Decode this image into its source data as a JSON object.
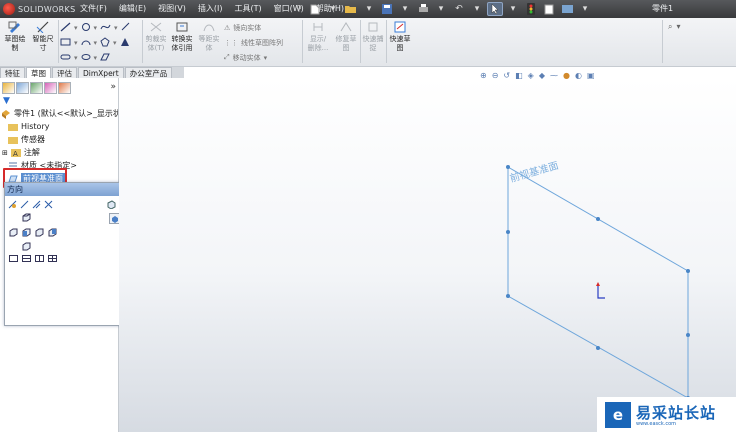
{
  "app": {
    "brand": "SOLIDWORKS",
    "menu": [
      "文件(F)",
      "编辑(E)",
      "视图(V)",
      "插入(I)",
      "工具(T)",
      "窗口(W)",
      "帮助(H)"
    ],
    "document_title": "零件1"
  },
  "commandmanager": {
    "sketch_buttons": [
      {
        "label": "草图绘\n制"
      },
      {
        "label": "智能尺\n寸"
      }
    ],
    "convert_buttons": [
      {
        "label": "剪裁实\n体(T)",
        "disabled": true
      },
      {
        "label": "转换实\n体引用",
        "disabled": false
      },
      {
        "label": "等距实\n体",
        "disabled": true
      }
    ],
    "mirror_group": [
      {
        "label": "镜向实体"
      },
      {
        "label": "线性草图阵列"
      },
      {
        "label": "移动实体"
      }
    ],
    "relation_buttons": [
      {
        "label": "显示/\n删除...",
        "disabled": true
      },
      {
        "label": "修复草\n图",
        "disabled": true
      },
      {
        "label": "快速捕\n捉",
        "disabled": true
      },
      {
        "label": "快速草\n图",
        "disabled": false
      }
    ]
  },
  "tabs": [
    "特征",
    "草图",
    "评估",
    "DimXpert",
    "办公室产品"
  ],
  "active_tab": "草图",
  "feature_tree": {
    "root": "零件1 (默认<<默认>_显示状",
    "items": [
      {
        "label": "History"
      },
      {
        "label": "传感器"
      },
      {
        "label": "注解"
      },
      {
        "label": "材质 <未指定>"
      },
      {
        "label": "前视基准面"
      }
    ]
  },
  "orientation_panel": {
    "title": "方向"
  },
  "viewport": {
    "plane_label": "前视基准面"
  },
  "watermark": {
    "title": "易采站长站",
    "url": "www.easck.com"
  },
  "colors": {
    "title_bar": "#3f4143",
    "accent": "#3b83c9",
    "highlight_box": "#d62a2a",
    "plane_line": "#6ea6db"
  }
}
